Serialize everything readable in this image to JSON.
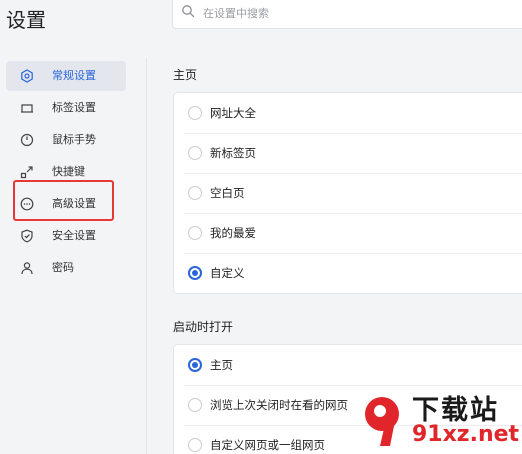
{
  "header": {
    "title": "设置",
    "search_placeholder": "在设置中搜索"
  },
  "sidebar": {
    "items": [
      {
        "label": "常规设置",
        "icon": "gear-icon",
        "active": true
      },
      {
        "label": "标签设置",
        "icon": "tab-icon",
        "active": false
      },
      {
        "label": "鼠标手势",
        "icon": "mouse-icon",
        "active": false
      },
      {
        "label": "快捷键",
        "icon": "shortcut-icon",
        "active": false
      },
      {
        "label": "高级设置",
        "icon": "more-icon",
        "active": false
      },
      {
        "label": "安全设置",
        "icon": "shield-icon",
        "active": false
      },
      {
        "label": "密码",
        "icon": "user-icon",
        "active": false
      }
    ]
  },
  "homepage": {
    "title": "主页",
    "options": [
      {
        "label": "网址大全",
        "checked": false
      },
      {
        "label": "新标签页",
        "checked": false
      },
      {
        "label": "空白页",
        "checked": false
      },
      {
        "label": "我的最爱",
        "checked": false
      },
      {
        "label": "自定义",
        "checked": true
      }
    ]
  },
  "startup": {
    "title": "启动时打开",
    "options": [
      {
        "label": "主页",
        "checked": true
      },
      {
        "label": "浏览上次关闭时在看的网页",
        "checked": false
      },
      {
        "label": "自定义网页或一组网页",
        "checked": false
      }
    ]
  },
  "watermark": {
    "title": "下载站",
    "url": "91xz.net"
  },
  "colors": {
    "accent": "#2a66d9",
    "highlight": "#e53935",
    "watermark_red": "#e0262a"
  }
}
